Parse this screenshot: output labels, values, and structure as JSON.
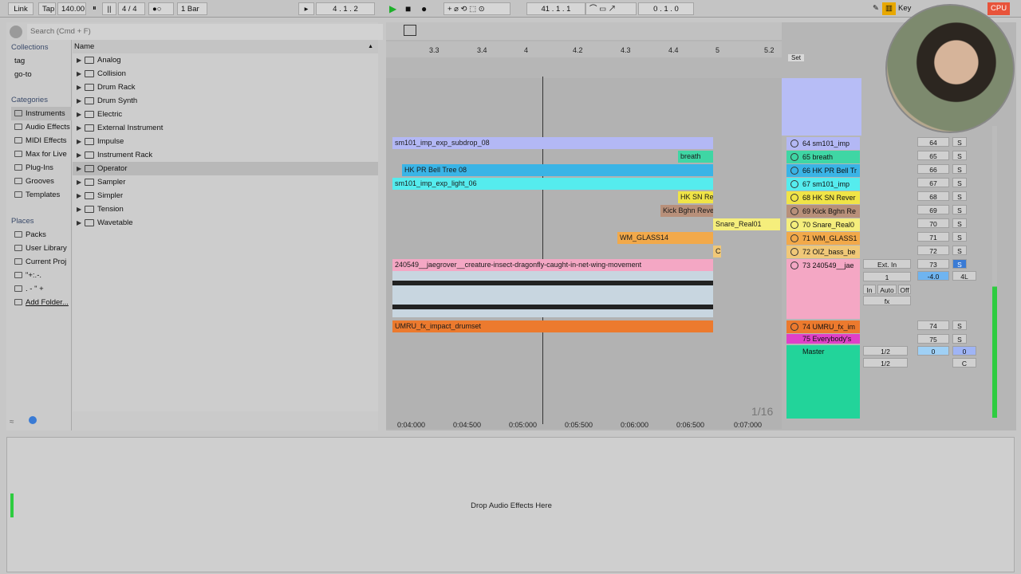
{
  "toolbar": {
    "link": "Link",
    "tap": "Tap",
    "tempo": "140.00",
    "signature": "4 / 4",
    "metro": "●○",
    "quantize": "1 Bar",
    "position": "4 .   1 .   2",
    "loop_start": "41 .   1 .   1",
    "loop_length": "0 .   1 .   0",
    "key": "Key",
    "cpu": "CPU"
  },
  "browser": {
    "search_placeholder": "Search (Cmd + F)",
    "collections_title": "Collections",
    "collections": [
      "tag",
      "go-to"
    ],
    "categories_title": "Categories",
    "categories": [
      "Instruments",
      "Audio Effects",
      "MIDI Effects",
      "Max for Live",
      "Plug-Ins",
      "Grooves",
      "Templates"
    ],
    "places_title": "Places",
    "places": [
      "Packs",
      "User Library",
      "Current Proj",
      "\"+:.-.",
      ". - \" +",
      "Add Folder..."
    ],
    "column_name": "Name",
    "items": [
      "Analog",
      "Collision",
      "Drum Rack",
      "Drum Synth",
      "Electric",
      "External Instrument",
      "Impulse",
      "Instrument Rack",
      "Operator",
      "Sampler",
      "Simpler",
      "Tension",
      "Wavetable"
    ],
    "selected_item": "Operator"
  },
  "arrangement": {
    "ruler": [
      "3.3",
      "3.4",
      "4",
      "4.2",
      "4.3",
      "4.4",
      "5",
      "5.2"
    ],
    "set_label": "Set",
    "clips": [
      "sm101_imp_exp_subdrop_08",
      "breath",
      "HK PR Bell Tree 08",
      "sm101_imp_exp_light_06",
      "HK SN Rev",
      "Kick Bghn Reve",
      "Snare_Real01",
      "WM_GLASS14",
      "C",
      "240549__jaegrover__creature-insect-dragonfly-caught-in-net-wing-movement",
      "UMRU_fx_impact_drumset"
    ],
    "timeline": [
      "0:04:000",
      "0:04:500",
      "0:05:000",
      "0:05:500",
      "0:06:000",
      "0:06:500",
      "0:07:000"
    ],
    "grid": "1/16"
  },
  "mixer": {
    "tracks": [
      {
        "name": "64 sm101_imp",
        "num": "64",
        "color": "#b3b8f5"
      },
      {
        "name": "65 breath",
        "num": "65",
        "color": "#3fd6a4"
      },
      {
        "name": "66 HK PR Bell Tr",
        "num": "66",
        "color": "#3ab4e6"
      },
      {
        "name": "67 sm101_imp",
        "num": "67",
        "color": "#55ecee"
      },
      {
        "name": "68 HK SN Rever",
        "num": "68",
        "color": "#f0e447"
      },
      {
        "name": "69 Kick Bghn Re",
        "num": "69",
        "color": "#b8907a"
      },
      {
        "name": "70 Snare_Real0",
        "num": "70",
        "color": "#f5ee7c"
      },
      {
        "name": "71 WM_GLASS1",
        "num": "71",
        "color": "#f2a94a"
      },
      {
        "name": "72 OIZ_bass_be",
        "num": "72",
        "color": "#f0c878"
      },
      {
        "name": "73 240549__jae",
        "num": "73",
        "color": "#f4a7c4"
      },
      {
        "name": "74 UMRU_fx_im",
        "num": "74",
        "color": "#ec7a2e"
      },
      {
        "name": "75 Everybody's",
        "num": "75",
        "color": "#e040c8"
      }
    ],
    "master": "Master",
    "input": "Ext. In",
    "in_channel": "1",
    "monitor": [
      "In",
      "Auto",
      "Off"
    ],
    "fx": "fx",
    "volume": "-4.0",
    "pan": "4L",
    "master_out": "1/2",
    "master_vol": "0",
    "master_pan": "C",
    "solo": "S"
  },
  "detail": {
    "drop_text": "Drop Audio Effects Here"
  }
}
